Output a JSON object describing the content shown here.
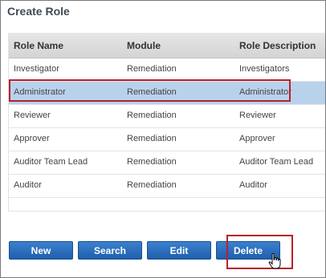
{
  "panel": {
    "title": "Create Role"
  },
  "grid": {
    "columns": [
      "Role Name",
      "Module",
      "Role Description"
    ],
    "rows": [
      {
        "role_name": "Investigator",
        "module": "Remediation",
        "description": "Investigators",
        "selected": false
      },
      {
        "role_name": "Administrator",
        "module": "Remediation",
        "description": "Administrator",
        "selected": true
      },
      {
        "role_name": "Reviewer",
        "module": "Remediation",
        "description": "Reviewer",
        "selected": false
      },
      {
        "role_name": "Approver",
        "module": "Remediation",
        "description": "Approver",
        "selected": false
      },
      {
        "role_name": "Auditor Team Lead",
        "module": "Remediation",
        "description": "Auditor Team Lead",
        "selected": false
      },
      {
        "role_name": "Auditor",
        "module": "Remediation",
        "description": "Auditor",
        "selected": false
      }
    ]
  },
  "buttons": {
    "new_label": "New",
    "search_label": "Search",
    "edit_label": "Edit",
    "delete_label": "Delete"
  },
  "colors": {
    "button_blue": "#2a6ebd",
    "selected_row": "#b9d2ec",
    "highlight_red": "#b8202a",
    "title_text": "#3f4b57"
  },
  "icons": {
    "cursor": "hand-pointer-icon"
  }
}
